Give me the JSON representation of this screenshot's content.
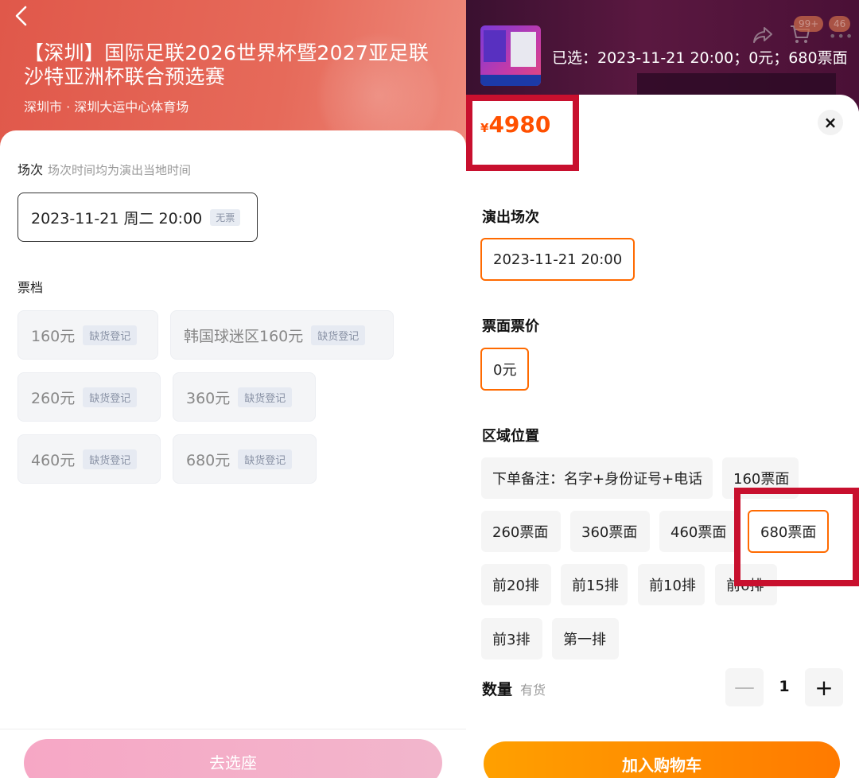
{
  "left": {
    "back_icon": "chevron-left-icon",
    "title": "【深圳】国际足联2026世界杯暨2027亚足联沙特亚洲杯联合预选赛",
    "venue": "深圳市 · 深圳大运中心体育场",
    "session_label": "场次",
    "session_hint": "场次时间均为演出当地时间",
    "session_value": "2023-11-21 周二 20:00",
    "session_tag": "无票",
    "tier_label": "票档",
    "tiers": [
      {
        "label": "160元",
        "tag": "缺货登记"
      },
      {
        "label": "韩国球迷区160元",
        "tag": "缺货登记"
      },
      {
        "label": "260元",
        "tag": "缺货登记"
      },
      {
        "label": "360元",
        "tag": "缺货登记"
      },
      {
        "label": "460元",
        "tag": "缺货登记"
      },
      {
        "label": "680元",
        "tag": "缺货登记"
      }
    ],
    "select_seat_button": "去选座"
  },
  "right": {
    "selected_text": "已选：2023-11-21 20:00；0元；680票面",
    "badge_cart": "99+",
    "badge_msg": "46",
    "price_yen": "¥",
    "price_value": "4980",
    "close_icon": "×",
    "session_label": "演出场次",
    "session_value": "2023-11-21 20:00",
    "face_label": "票面票价",
    "face_value": "0元",
    "area_label": "区域位置",
    "areas": [
      "下单备注：名字+身份证号+电话",
      "160票面",
      "260票面",
      "360票面",
      "460票面",
      "680票面",
      "前20排",
      "前15排",
      "前10排",
      "前6排",
      "前3排",
      "第一排"
    ],
    "qty_label": "数量",
    "qty_hint": "有货",
    "qty_minus": "—",
    "qty_value": "1",
    "qty_plus": "+",
    "add_cart_button": "加入购物车"
  },
  "colors": {
    "hero_red": "#e0584a",
    "price_orange": "#ff5000",
    "active_border": "#ff6a00",
    "highlight_red": "#c8102e",
    "cart_button": "#ff8c00",
    "seat_button": "#f6a7c5"
  }
}
